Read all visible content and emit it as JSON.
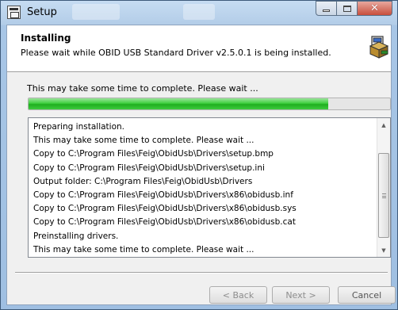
{
  "window": {
    "title": "Setup"
  },
  "header": {
    "title": "Installing",
    "subtitle": "Please wait while OBID USB Standard Driver v2.5.0.1 is being installed."
  },
  "status": {
    "text": "This may take some time to complete. Please wait ...",
    "progress_fraction": 0.83,
    "progress_color": "#1fae1f"
  },
  "log": {
    "lines": [
      "Preparing installation.",
      "This may take some time to complete. Please wait ...",
      "Copy to C:\\Program Files\\Feig\\ObidUsb\\Drivers\\setup.bmp",
      "Copy to C:\\Program Files\\Feig\\ObidUsb\\Drivers\\setup.ini",
      "Output folder: C:\\Program Files\\Feig\\ObidUsb\\Drivers",
      "Copy to C:\\Program Files\\Feig\\ObidUsb\\Drivers\\x86\\obidusb.inf",
      "Copy to C:\\Program Files\\Feig\\ObidUsb\\Drivers\\x86\\obidusb.sys",
      "Copy to C:\\Program Files\\Feig\\ObidUsb\\Drivers\\x86\\obidusb.cat",
      "Preinstalling drivers.",
      "This may take some time to complete. Please wait ..."
    ]
  },
  "buttons": {
    "back": "< Back",
    "next": "Next >",
    "cancel": "Cancel"
  },
  "icons": {
    "window": "setup-window-icon",
    "installer": "installer-box-icon",
    "minimize": "minimize-icon",
    "maximize": "maximize-icon",
    "close": "close-icon",
    "scroll_up": "arrow-up-icon",
    "scroll_down": "arrow-down-icon"
  }
}
